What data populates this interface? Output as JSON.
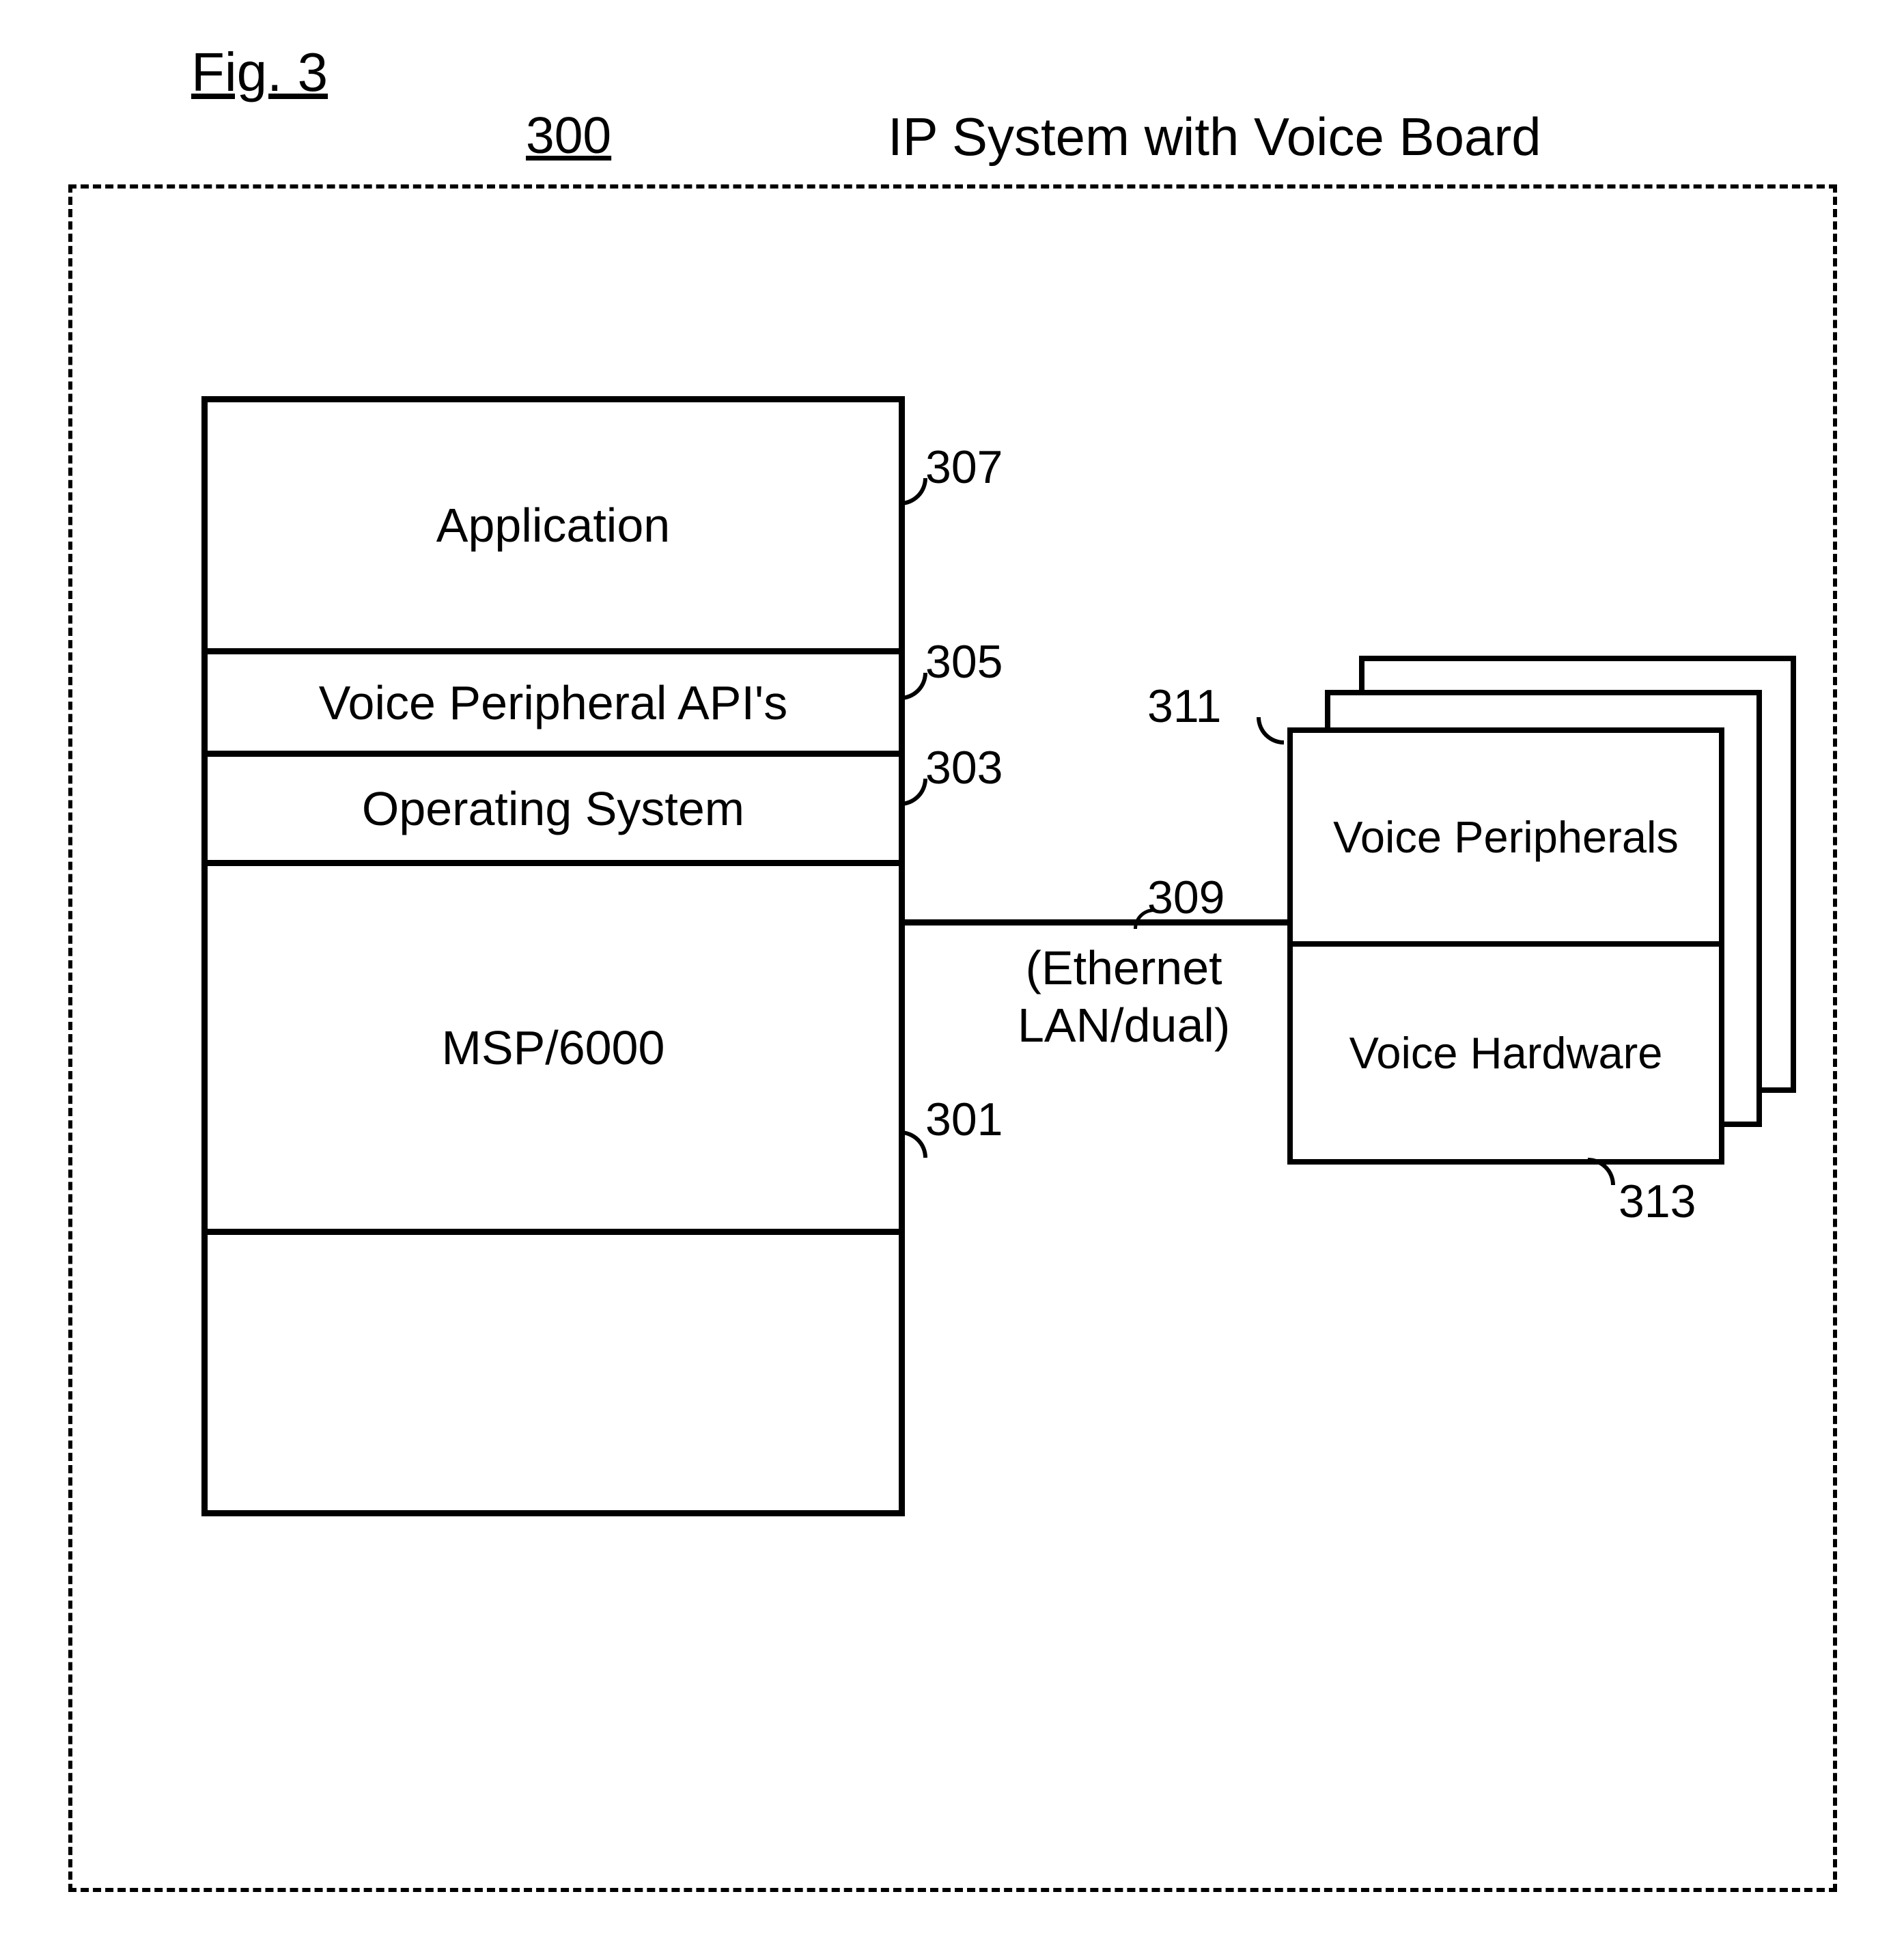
{
  "figure_label": "Fig. 3",
  "figure_ref": "300",
  "title": "IP System with Voice Board",
  "left_stack": {
    "application": "Application",
    "api": "Voice Peripheral API's",
    "os": "Operating System",
    "msp": "MSP/6000"
  },
  "connection": {
    "ref": "309",
    "label_line1": "(Ethernet",
    "label_line2": "LAN/dual)"
  },
  "right_stack": {
    "top": "Voice Peripherals",
    "bottom": "Voice Hardware"
  },
  "refs": {
    "r301": "301",
    "r303": "303",
    "r305": "305",
    "r307": "307",
    "r311": "311",
    "r313": "313"
  }
}
